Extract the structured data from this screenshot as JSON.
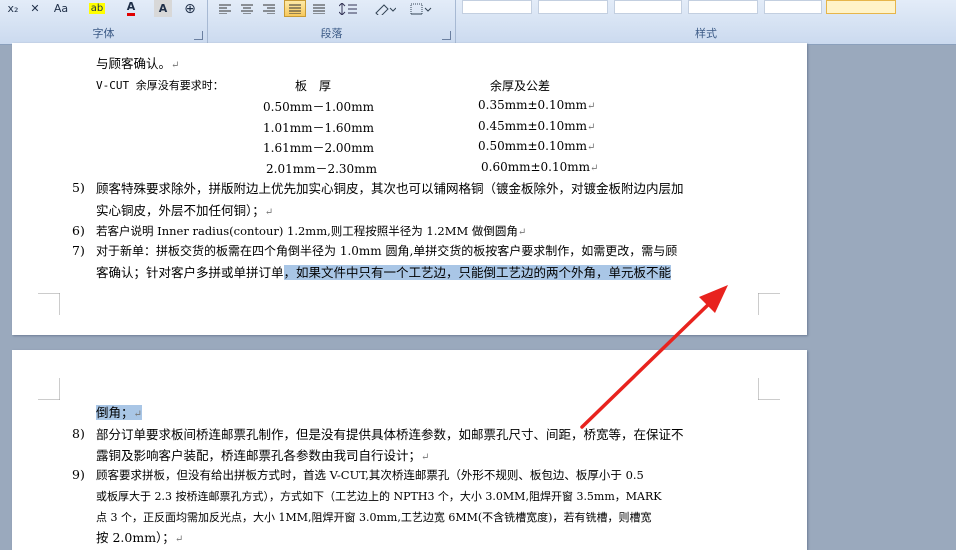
{
  "ribbon": {
    "font_group_label": "字体",
    "paragraph_group_label": "段落",
    "styles_group_label": "样式",
    "font_buttons": {
      "subscript": "x₂",
      "superscript_clear": "✕",
      "case": "Aa",
      "highlight": "ab",
      "font_color": "A",
      "char_shade": "A",
      "enclose": "⊕"
    }
  },
  "page1": {
    "lines": [
      "与顾客确认。",
      "V-CUT 余厚没有要求时：",
      "板　厚",
      "余厚及公差"
    ],
    "table": [
      {
        "thickness": "0.50mm－1.00mm",
        "tolerance": "0.35mm±0.10mm"
      },
      {
        "thickness": "1.01mm－1.60mm",
        "tolerance": "0.45mm±0.10mm"
      },
      {
        "thickness": "1.61mm－2.00mm",
        "tolerance": "0.50mm±0.10mm"
      },
      {
        "thickness": "2.01mm－2.30mm",
        "tolerance": "0.60mm±0.10mm"
      }
    ],
    "items": {
      "n5": "5)",
      "t5a": "顾客特殊要求除外，拼版附边上优先加实心铜皮，其次也可以铺网格铜（镀金板除外，对镀金板附边内层加",
      "t5b": "实心铜皮，外层不加任何铜）；",
      "n6": "6)",
      "t6": "若客户说明 Inner radius(contour) 1.2mm,则工程按照半径为 1.2MM 做倒圆角",
      "n7": "7)",
      "t7a": "对于新单：拼板交货的板需在四个角倒半径为 1.0mm 圆角,单拼交货的板按客户要求制作，如需更改，需与顾",
      "t7b_plain": "客确认；针对客户多拼或单拼订单",
      "t7b_highlight": "，如果文件中只有一个工艺边，只能倒工艺边的两个外角，单元板不能"
    }
  },
  "page2": {
    "first_highlight": "倒角；",
    "n8": "8)",
    "t8a": "部分订单要求板间桥连邮票孔制作，但是没有提供具体桥连参数，如邮票孔尺寸、间距，桥宽等，在保证不",
    "t8b": "露铜及影响客户装配，桥连邮票孔各参数由我司自行设计；",
    "n9": "9)",
    "t9a": "顾客要求拼板，但没有给出拼板方式时，首选 V-CUT,其次桥连邮票孔（外形不规则、板包边、板厚小于 0.5",
    "t9b": "或板厚大于 2.3 按桥连邮票孔方式），方式如下（工艺边上的 NPTH3 个，大小 3.0MM,阻焊开窗 3.5mm，MARK",
    "t9c": "点 3 个，正反面均需加反光点，大小 1MM,阻焊开窗 3.0mm,工艺边宽 6MM(不含铣槽宽度)，若有铣槽，则槽宽",
    "t9d": "按 2.0mm）；"
  },
  "colors": {
    "annotation_arrow": "#e8231e",
    "selection": "#a9c6e6"
  }
}
